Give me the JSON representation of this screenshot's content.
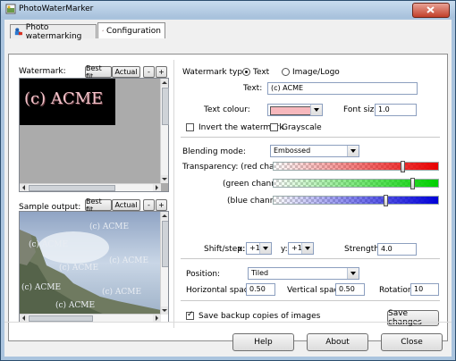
{
  "window": {
    "title": "PhotoWaterMarker"
  },
  "tabs": [
    {
      "label": "Photo watermarking",
      "icon": "photo-watermarking-icon"
    },
    {
      "label": "Configuration",
      "icon": "configuration-icon"
    }
  ],
  "left": {
    "watermark_label": "Watermark:",
    "sample_label": "Sample output:",
    "best_fit": "Best fit",
    "actual": "Actual",
    "minus": "-",
    "plus": "+",
    "watermark_preview_text": "(c) ACME",
    "sample_watermark_text": "(c) ACME"
  },
  "config": {
    "watermark_type_label": "Watermark type:",
    "type_text": "Text",
    "type_image": "Image/Logo",
    "type_selected": "Text",
    "text_label": "Text:",
    "text_value": "(c) ACME",
    "text_colour_label": "Text colour:",
    "text_colour": "#f7b8bd",
    "font_size_label": "Font size:",
    "font_size_value": "1.0",
    "invert_label": "Invert the watermark",
    "invert_checked": false,
    "grayscale_label": "Grayscale",
    "grayscale_checked": false,
    "blending_label": "Blending mode:",
    "blending_value": "Embossed",
    "transparency_label": "Transparency: (red channel):",
    "green_label": "(green channel):",
    "blue_label": "(blue channel):",
    "red_level": 0.78,
    "green_level": 0.84,
    "blue_level": 0.68,
    "shift_label": "Shift/step:",
    "x_label": "x:",
    "x_value": "+1",
    "y_label": "y:",
    "y_value": "+1",
    "strength_label": "Strength:",
    "strength_value": "4.0",
    "position_label": "Position:",
    "position_value": "Tiled",
    "hspacing_label": "Horizontal spacing:",
    "hspacing_value": "0.50",
    "vspacing_label": "Vertical spacing:",
    "vspacing_value": "0.50",
    "rotation_label": "Rotation:",
    "rotation_value": "10",
    "backup_label": "Save backup copies of images",
    "backup_checked": true,
    "save_changes": "Save changes"
  },
  "footer": {
    "help": "Help",
    "about": "About",
    "close": "Close"
  },
  "colors": {
    "red": "#e80000",
    "green": "#00d000",
    "blue": "#0000d8",
    "titlebar": "#b6cde6"
  }
}
